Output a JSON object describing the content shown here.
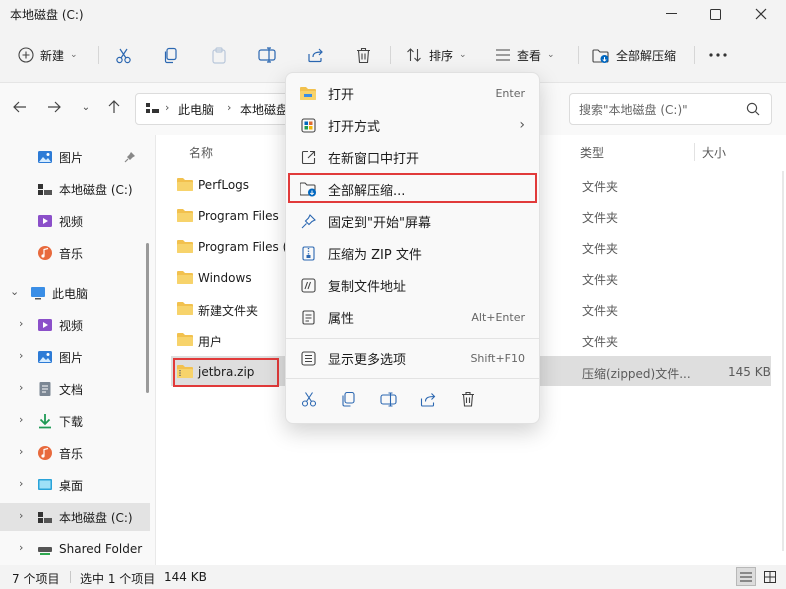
{
  "window": {
    "title": "本地磁盘 (C:)"
  },
  "toolbar": {
    "new_label": "新建",
    "sort_label": "排序",
    "view_label": "查看",
    "extract_label": "全部解压缩"
  },
  "address": {
    "part1": "此电脑",
    "part2": "本地磁盘"
  },
  "search": {
    "placeholder": "搜索\"本地磁盘 (C:)\""
  },
  "sidebar": {
    "pinned": [
      {
        "label": "图片",
        "icon": "pictures-icon"
      },
      {
        "label": "本地磁盘 (C:)",
        "icon": "drive-icon"
      },
      {
        "label": "视频",
        "icon": "videos-icon"
      },
      {
        "label": "音乐",
        "icon": "music-icon"
      }
    ],
    "thispc": "此电脑",
    "children": [
      {
        "label": "视频",
        "icon": "videos-icon"
      },
      {
        "label": "图片",
        "icon": "pictures-icon"
      },
      {
        "label": "文档",
        "icon": "documents-icon"
      },
      {
        "label": "下载",
        "icon": "downloads-icon"
      },
      {
        "label": "音乐",
        "icon": "music-icon"
      },
      {
        "label": "桌面",
        "icon": "desktop-icon"
      },
      {
        "label": "本地磁盘 (C:)",
        "icon": "drive-icon"
      },
      {
        "label": "Shared Folder",
        "icon": "network-drive-icon"
      }
    ]
  },
  "columns": {
    "name": "名称",
    "type": "类型",
    "size": "大小"
  },
  "files": [
    {
      "name": "PerfLogs",
      "type": "文件夹"
    },
    {
      "name": "Program Files",
      "type": "文件夹"
    },
    {
      "name": "Program Files (",
      "type": "文件夹"
    },
    {
      "name": "Windows",
      "type": "文件夹"
    },
    {
      "name": "新建文件夹",
      "type": "文件夹"
    },
    {
      "name": "用户",
      "type": "文件夹"
    },
    {
      "name": "jetbra.zip",
      "type": "压缩(zipped)文件...",
      "size": "145 KB"
    }
  ],
  "status": {
    "count": "7 个项目",
    "selected": "选中 1 个项目",
    "size": "144 KB"
  },
  "context_menu": {
    "items": [
      {
        "label": "打开",
        "shortcut": "Enter"
      },
      {
        "label": "打开方式",
        "shortcut": ""
      },
      {
        "label": "在新窗口中打开",
        "shortcut": ""
      },
      {
        "label": "全部解压缩...",
        "shortcut": ""
      },
      {
        "label": "固定到\"开始\"屏幕",
        "shortcut": ""
      },
      {
        "label": "压缩为 ZIP 文件",
        "shortcut": ""
      },
      {
        "label": "复制文件地址",
        "shortcut": ""
      },
      {
        "label": "属性",
        "shortcut": "Alt+Enter"
      },
      {
        "label": "显示更多选项",
        "shortcut": "Shift+F10"
      }
    ]
  },
  "colors": {
    "accent": "#0067c0",
    "highlight": "#e13a3a",
    "folder": "#f2c14e"
  }
}
